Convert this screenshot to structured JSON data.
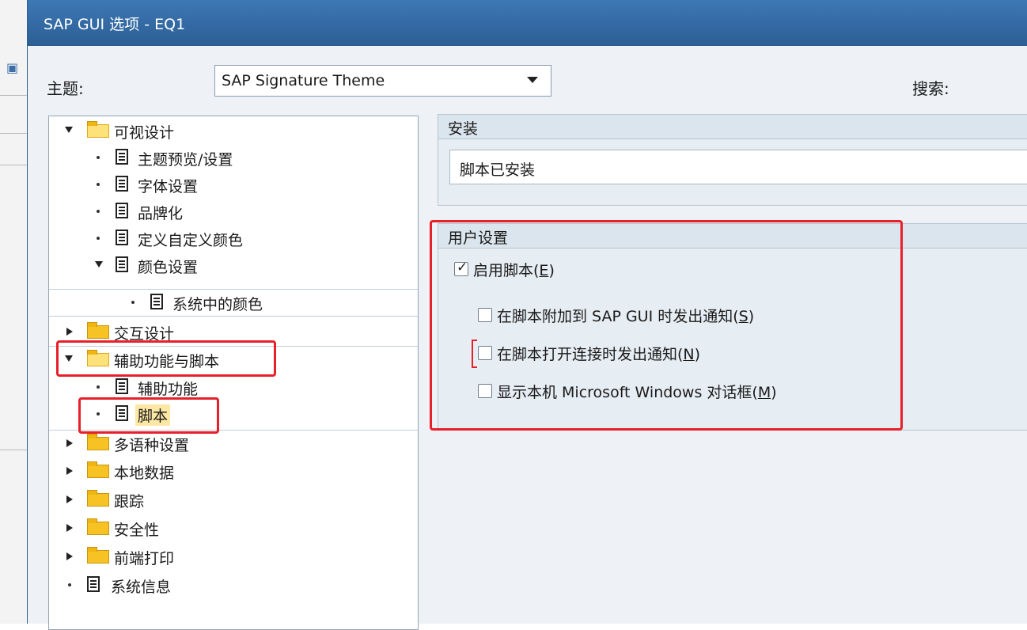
{
  "window": {
    "title": "SAP GUI 选项 - EQ1"
  },
  "theme": {
    "label": "主题:",
    "selected": "SAP Signature Theme"
  },
  "search": {
    "label": "搜索:"
  },
  "tree": [
    "可视设计",
    "主题预览/设置",
    "字体设置",
    "品牌化",
    "定义自定义颜色",
    "颜色设置",
    "系统中的颜色",
    "交互设计",
    "辅助功能与脚本",
    "辅助功能",
    "脚本",
    "多语种设置",
    "本地数据",
    "跟踪",
    "安全性",
    "前端打印",
    "系统信息"
  ],
  "install": {
    "header": "安装",
    "value": "脚本已安装"
  },
  "user_settings": {
    "header": "用户设置",
    "enable_scripting": {
      "label": "启用脚本(",
      "key": "E",
      "close": ")",
      "checked": true
    },
    "notify_attach": {
      "label": "在脚本附加到 SAP GUI 时发出通知(",
      "key": "S",
      "close": ")",
      "checked": false
    },
    "notify_connection": {
      "label": "在脚本打开连接时发出通知(",
      "key": "N",
      "close": ")",
      "checked": false
    },
    "native_dialogs": {
      "label": "显示本机 Microsoft Windows 对话框(",
      "key": "M",
      "close": ")",
      "checked": false
    }
  },
  "colors": {
    "titlebar": "#2c5e93",
    "annotation": "#e8202a",
    "folder": "#f7c324"
  }
}
